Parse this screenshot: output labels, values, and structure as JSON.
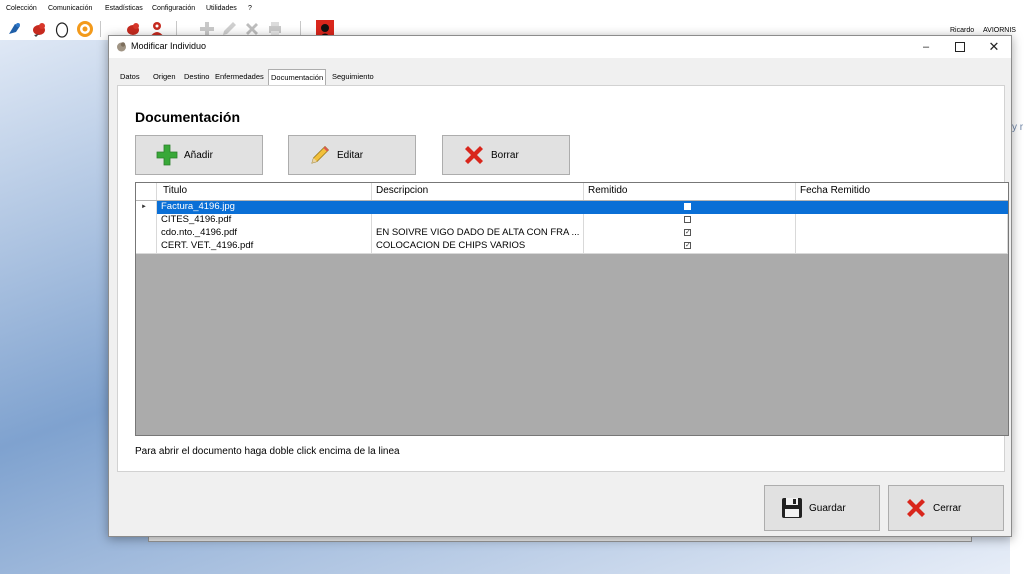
{
  "menu": [
    "Colección",
    "Comunicación",
    "Estadísticas",
    "Configuración",
    "Utilidades",
    "?"
  ],
  "user": {
    "name": "Ricardo",
    "org": "AVIORNIS"
  },
  "side_text": "y r",
  "dialog": {
    "title": "Modificar Individuo",
    "tabs": [
      "Datos",
      "Origen",
      "Destino",
      "Enfermedades",
      "Documentación",
      "Seguimiento"
    ],
    "active_tab": "Documentación",
    "section_title": "Documentación",
    "buttons": {
      "add": "Añadir",
      "edit": "Editar",
      "delete": "Borrar"
    },
    "grid": {
      "columns": [
        "Titulo",
        "Descripcion",
        "Remitido",
        "Fecha Remitido"
      ],
      "rows": [
        {
          "titulo": "Factura_4196.jpg",
          "descripcion": "",
          "remitido": false,
          "fecha": "",
          "selected": true
        },
        {
          "titulo": "CITES_4196.pdf",
          "descripcion": "",
          "remitido": false,
          "fecha": "",
          "selected": false
        },
        {
          "titulo": "cdo.nto._4196.pdf",
          "descripcion": "EN SOIVRE VIGO DADO DE ALTA CON FRA ...",
          "remitido": true,
          "fecha": "",
          "selected": false
        },
        {
          "titulo": "CERT. VET._4196.pdf",
          "descripcion": "COLOCACION DE CHIPS VARIOS",
          "remitido": true,
          "fecha": "",
          "selected": false
        }
      ]
    },
    "hint": "Para abrir el documento haga doble click encima de la linea",
    "footer": {
      "save": "Guardar",
      "close": "Cerrar"
    }
  },
  "colors": {
    "selection": "#0a6fd6",
    "grid_bg": "#ababab",
    "delete_red": "#d9261c",
    "add_green": "#38a838"
  }
}
